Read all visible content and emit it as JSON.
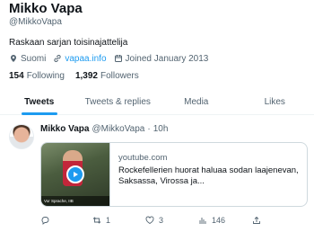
{
  "profile": {
    "name": "Mikko Vapa",
    "handle": "@MikkoVapa",
    "bio": "Raskaan sarjan toisinajattelija",
    "location": "Suomi",
    "website": "vapaa.info",
    "joined": "Joined January 2013",
    "following_count": "154",
    "following_label": "Following",
    "followers_count": "1,392",
    "followers_label": "Followers"
  },
  "tabs": [
    {
      "label": "Tweets",
      "active": true
    },
    {
      "label": "Tweets & replies",
      "active": false
    },
    {
      "label": "Media",
      "active": false
    },
    {
      "label": "Likes",
      "active": false
    }
  ],
  "tweet": {
    "author": "Mikko Vapa",
    "handle": "@MikkoVapa",
    "separator": "·",
    "time": "10h",
    "card": {
      "domain": "youtube.com",
      "title": "Rockefellerien huorat haluaa sodan laajenevan, Saksassa, Virossa ja...",
      "thumb_caption": "Vor Sprache, IIB"
    },
    "actions": {
      "reply_count": "",
      "retweet_count": "1",
      "like_count": "3",
      "views_count": "146"
    }
  },
  "colors": {
    "accent": "#1d9bf0",
    "text": "#0f1419",
    "muted": "#536471"
  }
}
